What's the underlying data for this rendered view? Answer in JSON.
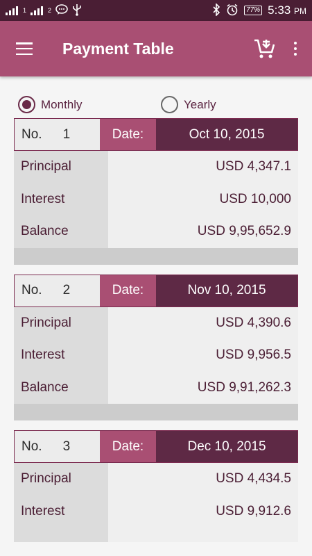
{
  "status_bar": {
    "signal1_label": "1",
    "signal2_label": "2",
    "battery": "77%",
    "time": "5:33",
    "ampm": "PM",
    "icons": [
      "signal-icon",
      "signal-icon",
      "message-icon",
      "usb-icon",
      "bluetooth-icon",
      "alarm-icon",
      "battery-icon"
    ]
  },
  "app_bar": {
    "title": "Payment Table",
    "icons": [
      "menu-icon",
      "add-to-cart-icon",
      "more-vert-icon"
    ]
  },
  "period": {
    "monthly_label": "Monthly",
    "yearly_label": "Yearly",
    "selected": "Monthly"
  },
  "labels": {
    "no": "No.",
    "date": "Date:",
    "principal": "Principal",
    "interest": "Interest",
    "balance": "Balance"
  },
  "payments": [
    {
      "no": "1",
      "date": "Oct 10, 2015",
      "principal": "USD 4,347.1",
      "interest": "USD 10,000",
      "balance": "USD 9,95,652.9"
    },
    {
      "no": "2",
      "date": "Nov 10, 2015",
      "principal": "USD 4,390.6",
      "interest": "USD 9,956.5",
      "balance": "USD 9,91,262.3"
    },
    {
      "no": "3",
      "date": "Dec 10, 2015",
      "principal": "USD 4,434.5",
      "interest": "USD 9,912.6",
      "balance": ""
    }
  ],
  "colors": {
    "status_bar": "#4a1e34",
    "app_bar": "#a94f73",
    "date_value_bg": "#5e2945",
    "text_dark": "#4a1d33"
  }
}
